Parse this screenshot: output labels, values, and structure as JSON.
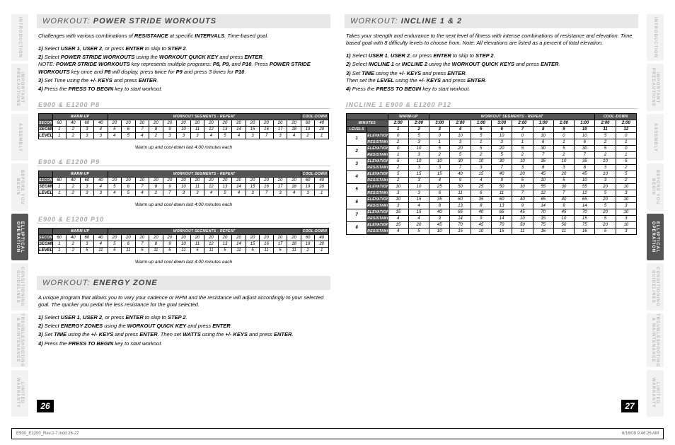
{
  "tabs": [
    "INTRODUCTION",
    "IMPORTANT PRECAUTIONS",
    "ASSEMBLY",
    "BEFORE YOU BEGIN",
    "ELLIPTICAL OPERATION",
    "CONDITIONING GUIDELINES",
    "TROUBLESHOOTING & MAINTENANCE",
    "LIMITED WARRANTY"
  ],
  "left": {
    "w1": {
      "titlePre": "WORKOUT: ",
      "titleMain": "POWER STRIDE WORKOUTS",
      "intro": "Challenges with various combinations of <b>RESISTANCE</b> at specific <b>INTERVALS</b>. Time-based goal.",
      "steps": [
        "Select <b>USER 1</b>, <b>USER 2</b>, or press <b>ENTER</b> to skip to <b>STEP 2</b>.",
        "Select <b>POWER STRIDE WORKOUTS</b> using the <b>WORKOUT QUICK KEY</b> and press <b>ENTER</b>.<br>NOTE: <b>POWER STRIDE WORKOUTS</b> key represents multiple programs: <b>P8, P9,</b> and <b>P10</b>. Press <b>POWER STRIDE WORKOUTS</b> key once and <b>P8</b> will display, press twice for <b>P9</b> and press 3 times for <b>P10</b>.",
        "Set Time using the <b>+/- KEYS</b> and press <b>ENTER</b>.",
        "Press the <b>PRESS TO BEGIN</b> key to start workout."
      ]
    },
    "p8": {
      "title": "E900 & E1200 P8",
      "seconds": [
        60,
        40,
        60,
        40,
        20,
        20,
        20,
        20,
        20,
        20,
        20,
        20,
        20,
        20,
        20,
        20,
        20,
        20,
        60,
        40
      ],
      "segment": [
        1,
        2,
        3,
        4,
        5,
        6,
        7,
        8,
        9,
        10,
        11,
        12,
        13,
        14,
        15,
        16,
        17,
        18,
        19,
        20
      ],
      "level": [
        1,
        2,
        3,
        3,
        4,
        5,
        4,
        2,
        3,
        3,
        3,
        4,
        5,
        4,
        3,
        7,
        3,
        4,
        2,
        1
      ],
      "note": "Warm up and cool-down last 4:00 minutes each"
    },
    "p9": {
      "title": "E900 & E1200 P9",
      "seconds": [
        60,
        40,
        60,
        40,
        20,
        20,
        20,
        20,
        20,
        20,
        20,
        20,
        20,
        20,
        20,
        20,
        20,
        20,
        60,
        40
      ],
      "segment": [
        1,
        2,
        3,
        4,
        5,
        6,
        7,
        8,
        9,
        10,
        11,
        12,
        13,
        14,
        15,
        16,
        17,
        18,
        19,
        20
      ],
      "level": [
        1,
        2,
        3,
        3,
        4,
        5,
        4,
        2,
        7,
        3,
        3,
        4,
        5,
        4,
        3,
        7,
        3,
        4,
        3,
        1
      ],
      "note": "Warm up and cool-down last 4:00 minutes each"
    },
    "p10": {
      "title": "E900 & E1200 P10",
      "seconds": [
        60,
        40,
        60,
        40,
        20,
        20,
        20,
        20,
        20,
        20,
        20,
        20,
        20,
        20,
        20,
        20,
        20,
        20,
        60,
        40
      ],
      "segment": [
        1,
        2,
        3,
        4,
        5,
        6,
        7,
        8,
        9,
        10,
        11,
        12,
        13,
        14,
        15,
        16,
        17,
        18,
        19,
        20
      ],
      "level": [
        1,
        2,
        5,
        11,
        5,
        11,
        5,
        11,
        5,
        11,
        5,
        11,
        5,
        11,
        5,
        11,
        5,
        11,
        2,
        1
      ],
      "note": "Warm up and cool-down last 4:00 minutes each"
    },
    "w2": {
      "titlePre": "WORKOUT: ",
      "titleMain": "ENERGY ZONE",
      "intro": "A unique program that allows you to vary your cadence or RPM and the resistance will adjust accordingly to your selected goal. The quicker you pedal the less resistance for the goal selected.",
      "steps": [
        "Select <b>USER 1</b>, <b>USER 2</b>, or press <b>ENTER</b> to skip to <b>STEP 2</b>.",
        "Select <b>ENERGY ZONES</b> using the <b>WORKOUT QUICK KEY</b> and press <b>ENTER</b>.",
        "Set <b>TIME</b> using the <b>+/- KEYS</b> and press <b>ENTER</b>. Then set <b>WATTS</b> using the <b>+/- KEYS</b> and press <b>ENTER</b>.",
        "Press the <b>PRESS TO BEGIN</b> key to start workout."
      ]
    },
    "pageNum": "26"
  },
  "right": {
    "w": {
      "titlePre": "WORKOUT: ",
      "titleMain": "INCLINE 1 & 2",
      "intro": "Takes your strength and endurance to the next level of fitness with intense combinations of resistance and elevation. Time based goal with 8 difficulty levels to choose from. Note: All elevations are listed as a percent of total elevation.",
      "steps": [
        "Select <b>USER 1</b>, <b>USER 2</b>, or press <b>ENTER</b> to skip to <b>STEP 2</b>.",
        "Select <b>INCLINE 1</b> or <b>INCLINE 2</b> using the <b>WORKOUT QUICK KEYS</b> and press <b>ENTER</b>.",
        "Set <b>TIME</b> using the <b>+/- KEYS</b> and press <b>ENTER</b>.<br>Then set the <b>LEVEL</b> using the <b>+/- KEYS</b> and press <b>ENTER</b>.",
        "Press the <b>PRESS TO BEGIN</b> key to start workout."
      ]
    },
    "inc": {
      "title": "INCLINE 1 E900 & E1200 P12",
      "minutes": [
        "2:00",
        "2:00",
        "3:00",
        "2:00",
        "1:00",
        "3:00",
        "2:00",
        "1:00",
        "1:00",
        "1:00",
        "2:00",
        "2:00"
      ],
      "levelsHead": "LEVELS",
      "cols": [
        1,
        2,
        3,
        4,
        5,
        6,
        7,
        8,
        9,
        10,
        11,
        12
      ],
      "rows": [
        {
          "level": "1",
          "elev": [
            0,
            5,
            0,
            10,
            5,
            10,
            0,
            10,
            0,
            10,
            5,
            0
          ],
          "res": [
            2,
            3,
            1,
            3,
            1,
            3,
            1,
            6,
            1,
            6,
            2,
            1
          ]
        },
        {
          "level": "2",
          "elev": [
            0,
            10,
            5,
            20,
            5,
            20,
            5,
            30,
            5,
            30,
            5,
            0
          ],
          "res": [
            1,
            3,
            2,
            5,
            2,
            5,
            2,
            7,
            2,
            7,
            2,
            1
          ]
        },
        {
          "level": "3",
          "elev": [
            5,
            10,
            10,
            30,
            10,
            30,
            10,
            35,
            10,
            35,
            10,
            5
          ],
          "res": [
            2,
            3,
            3,
            7,
            3,
            7,
            3,
            8,
            3,
            8,
            3,
            2
          ]
        },
        {
          "level": "4",
          "elev": [
            5,
            15,
            15,
            40,
            15,
            40,
            20,
            45,
            20,
            45,
            10,
            5
          ],
          "res": [
            2,
            3,
            4,
            9,
            4,
            9,
            5,
            10,
            5,
            10,
            3,
            2
          ]
        },
        {
          "level": "5",
          "elev": [
            10,
            10,
            25,
            50,
            25,
            50,
            30,
            55,
            30,
            55,
            20,
            10
          ],
          "res": [
            3,
            3,
            6,
            11,
            6,
            11,
            7,
            12,
            7,
            12,
            5,
            3
          ]
        },
        {
          "level": "6",
          "elev": [
            10,
            15,
            35,
            60,
            35,
            60,
            40,
            65,
            40,
            65,
            20,
            10
          ],
          "res": [
            3,
            4,
            8,
            13,
            8,
            13,
            9,
            14,
            9,
            14,
            5,
            3
          ]
        },
        {
          "level": "7",
          "elev": [
            15,
            15,
            40,
            65,
            40,
            65,
            45,
            70,
            45,
            70,
            20,
            10
          ],
          "res": [
            4,
            4,
            9,
            14,
            9,
            14,
            10,
            15,
            10,
            15,
            5,
            3
          ]
        },
        {
          "level": "8",
          "elev": [
            15,
            20,
            45,
            70,
            45,
            70,
            50,
            75,
            50,
            75,
            20,
            10
          ],
          "res": [
            4,
            5,
            10,
            15,
            10,
            15,
            11,
            16,
            11,
            16,
            5,
            3
          ]
        }
      ]
    },
    "pageNum": "27"
  },
  "bands": {
    "warmup": "WARM-UP",
    "segments": "WORKOUT SEGMENTS - REPEAT",
    "cooldown": "COOL-DOWN"
  },
  "rowLabels": {
    "seconds": "SECONDS",
    "segment": "SEGMENT",
    "level": "LEVEL",
    "minutes": "MINUTES",
    "elev": "ELEVATION",
    "res": "RESISTANCE"
  },
  "footer": {
    "l": "E900_E1200_Rev.2-7.indd   26-27",
    "r": "6/16/09   9:46:26 AM"
  }
}
